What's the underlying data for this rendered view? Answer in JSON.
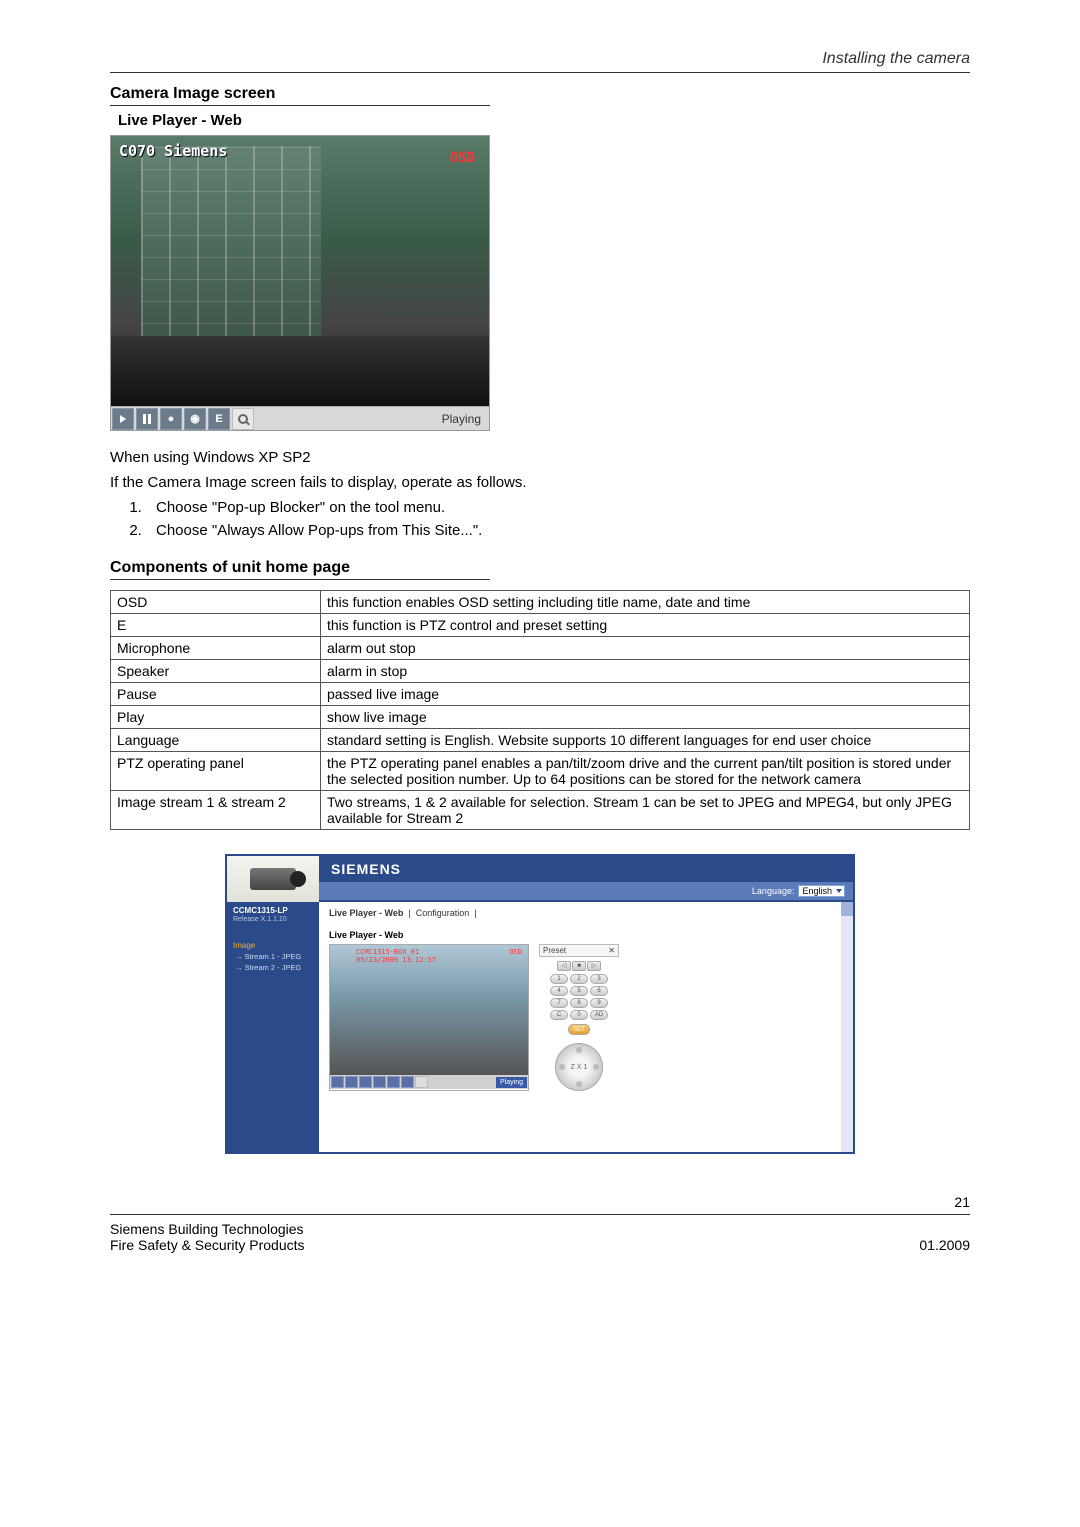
{
  "header": {
    "section": "Installing the camera"
  },
  "section1": {
    "title": "Camera Image screen",
    "player_title": "Live Player - Web",
    "overlay_text": "C070 Siemens",
    "overlay_osd": "OSD",
    "toolbar": {
      "play": "▶",
      "pause": "❚❚",
      "mic": "🎤",
      "spk": "🔊",
      "e": "E",
      "zoom": "🔍",
      "status": "Playing"
    },
    "note_line1": "When using Windows XP SP2",
    "note_line2": "If the Camera Image screen fails to display, operate as follows.",
    "steps": [
      "Choose \"Pop-up Blocker\" on the tool menu.",
      "Choose \"Always Allow Pop-ups from This Site...\"."
    ]
  },
  "section2": {
    "title": "Components of unit home page",
    "rows": [
      {
        "name": "OSD",
        "desc": "this function enables OSD setting including title name, date and time"
      },
      {
        "name": "E",
        "desc": "this function is PTZ control and preset setting"
      },
      {
        "name": "Microphone",
        "desc": "alarm out stop"
      },
      {
        "name": "Speaker",
        "desc": "alarm in stop"
      },
      {
        "name": "Pause",
        "desc": "passed live image"
      },
      {
        "name": "Play",
        "desc": "show live image"
      },
      {
        "name": "Language",
        "desc": "standard setting is English. Website supports 10 different languages for end user choice"
      },
      {
        "name": "PTZ operating panel",
        "desc": "the PTZ operating panel enables a pan/tilt/zoom drive and the current pan/tilt position is stored under the selected position number. Up to 64 positions can be stored for the network camera"
      },
      {
        "name": "Image stream 1 & stream 2",
        "desc": "Two streams, 1 & 2 available for selection. Stream 1 can be set to JPEG and MPEG4, but only JPEG available for Stream 2"
      }
    ]
  },
  "webui": {
    "brand": "SIEMENS",
    "language_label": "Language:",
    "language_value": "English",
    "model": "CCMC1315-LP",
    "release": "Release X.1.1.10",
    "sidebar": {
      "head": "Image",
      "items": [
        "→ Stream 1 - JPEG",
        "→ Stream 2 - JPEG"
      ]
    },
    "tabs": {
      "active": "Live Player - Web",
      "other": "Configuration"
    },
    "player_label": "Live Player - Web",
    "mini_overlay": {
      "line1": "CCMC1315-BOX_01",
      "line2": "05/23/2009 13:12:57",
      "osd": "OSD"
    },
    "mini_status": "Playing",
    "ptz": {
      "preset_label": "Preset",
      "close": "✕",
      "dir_left": "◁",
      "dir_stop": "■",
      "dir_right": "▷",
      "keys": [
        "1",
        "2",
        "3",
        "4",
        "5",
        "6",
        "7",
        "8",
        "9",
        "C",
        "0",
        "AD"
      ],
      "set": "SET",
      "zoom": "Z X 1"
    }
  },
  "footer": {
    "page": "21",
    "company": "Siemens Building Technologies",
    "dept": "Fire Safety & Security Products",
    "date": "01.2009"
  }
}
